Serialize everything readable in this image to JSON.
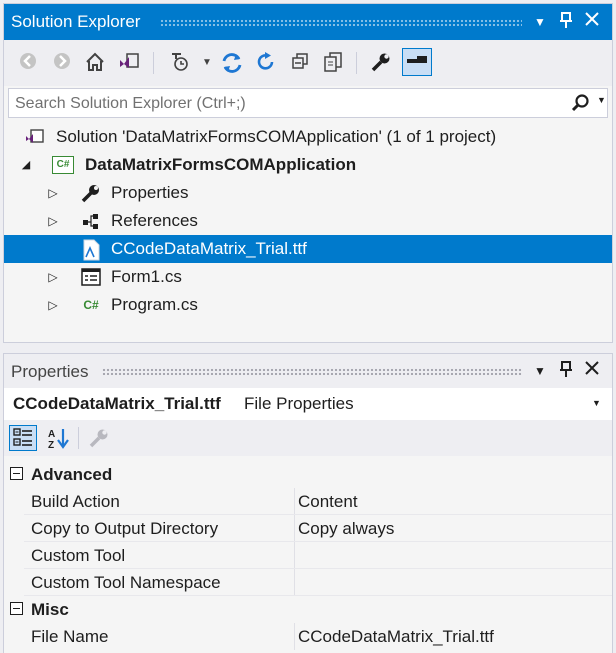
{
  "solution_explorer": {
    "title": "Solution Explorer",
    "search_placeholder": "Search Solution Explorer (Ctrl+;)",
    "toolbar_icons": [
      "back-icon",
      "forward-icon",
      "home-icon",
      "vs-switch-views-icon",
      "pending-changes-filter-icon",
      "dropdown-icon",
      "sync-active-doc-icon",
      "refresh-icon",
      "collapse-all-icon",
      "show-all-files-icon",
      "properties-wrench-icon",
      "preview-selected-icon"
    ],
    "tree": {
      "solution": "Solution 'DataMatrixFormsCOMApplication' (1 of 1 project)",
      "project": "DataMatrixFormsCOMApplication",
      "items": [
        {
          "label": "Properties",
          "icon": "wrench-icon",
          "expandable": true
        },
        {
          "label": "References",
          "icon": "references-icon",
          "expandable": true
        },
        {
          "label": "CCodeDataMatrix_Trial.ttf",
          "icon": "font-file-icon",
          "expandable": false,
          "selected": true
        },
        {
          "label": "Form1.cs",
          "icon": "form-icon",
          "expandable": true
        },
        {
          "label": "Program.cs",
          "icon": "csharp-file-icon",
          "expandable": true
        }
      ]
    },
    "accent_color": "#007acc"
  },
  "properties": {
    "title": "Properties",
    "object_name": "CCodeDataMatrix_Trial.ttf",
    "object_type": "File Properties",
    "categories": [
      {
        "name": "Advanced",
        "rows": [
          {
            "key": "Build Action",
            "value": "Content"
          },
          {
            "key": "Copy to Output Directory",
            "value": "Copy always"
          },
          {
            "key": "Custom Tool",
            "value": ""
          },
          {
            "key": "Custom Tool Namespace",
            "value": ""
          }
        ]
      },
      {
        "name": "Misc",
        "rows": [
          {
            "key": "File Name",
            "value": "CCodeDataMatrix_Trial.ttf"
          }
        ]
      }
    ]
  }
}
